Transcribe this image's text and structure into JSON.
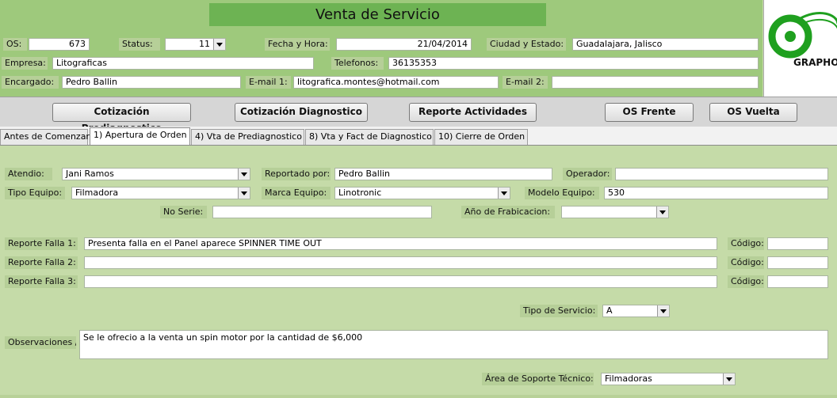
{
  "header": {
    "title": "Venta de Servicio",
    "logo_text": "GRAPHO",
    "os_label": "OS:",
    "os_value": "673",
    "status_label": "Status:",
    "status_value": "11",
    "fecha_label": "Fecha y Hora:",
    "fecha_value": "21/04/2014",
    "ciudad_label": "Ciudad y Estado:",
    "ciudad_value": "Guadalajara, Jalisco",
    "empresa_label": "Empresa:",
    "empresa_value": "Litograficas",
    "telefonos_label": "Telefonos:",
    "telefonos_value": "36135353",
    "encargado_label": "Encargado:",
    "encargado_value": "Pedro Ballin",
    "email1_label": "E-mail 1:",
    "email1_value": "litografica.montes@hotmail.com",
    "email2_label": "E-mail 2:",
    "email2_value": ""
  },
  "toolbar": {
    "cot_prediag": "Cotización Prediagnostico",
    "cot_diag": "Cotización Diagnostico",
    "reporte_act": "Reporte Actividades",
    "os_frente": "OS Frente",
    "os_vuelta": "OS Vuelta"
  },
  "tabs": [
    "Antes de Comenzar",
    "1) Apertura de Orden",
    "4) Vta de Prediagnostico",
    "8) Vta y Fact de Diagnostico",
    "10) Cierre de Orden"
  ],
  "form": {
    "atendio_label": "Atendio:",
    "atendio_value": "Jani Ramos",
    "reportado_label": "Reportado por:",
    "reportado_value": "Pedro Ballin",
    "operador_label": "Operador:",
    "operador_value": "",
    "tipo_label": "Tipo Equipo:",
    "tipo_value": "Filmadora",
    "marca_label": "Marca Equipo:",
    "marca_value": "Linotronic",
    "modelo_label": "Modelo Equipo:",
    "modelo_value": "530",
    "serie_label": "No Serie:",
    "serie_value": "",
    "anio_label": "Año de Frabicacion:",
    "anio_value": "",
    "falla1_label": "Reporte Falla 1:",
    "falla1_value": "Presenta falla en el Panel aparece SPINNER TIME OUT",
    "falla2_label": "Reporte Falla 2:",
    "falla2_value": "",
    "falla3_label": "Reporte Falla 3:",
    "falla3_value": "",
    "codigo_label": "Código:",
    "codigo1_value": "",
    "codigo2_value": "",
    "codigo3_value": "",
    "tipo_servicio_label": "Tipo de Servicio:",
    "tipo_servicio_value": "A",
    "observaciones_label": "Observaciones /",
    "observaciones_value": "Se le ofrecio a la venta un spin motor por la cantidad de $6,000",
    "area_label": "Área de Soporte Técnico:",
    "area_value": "Filmadoras"
  }
}
